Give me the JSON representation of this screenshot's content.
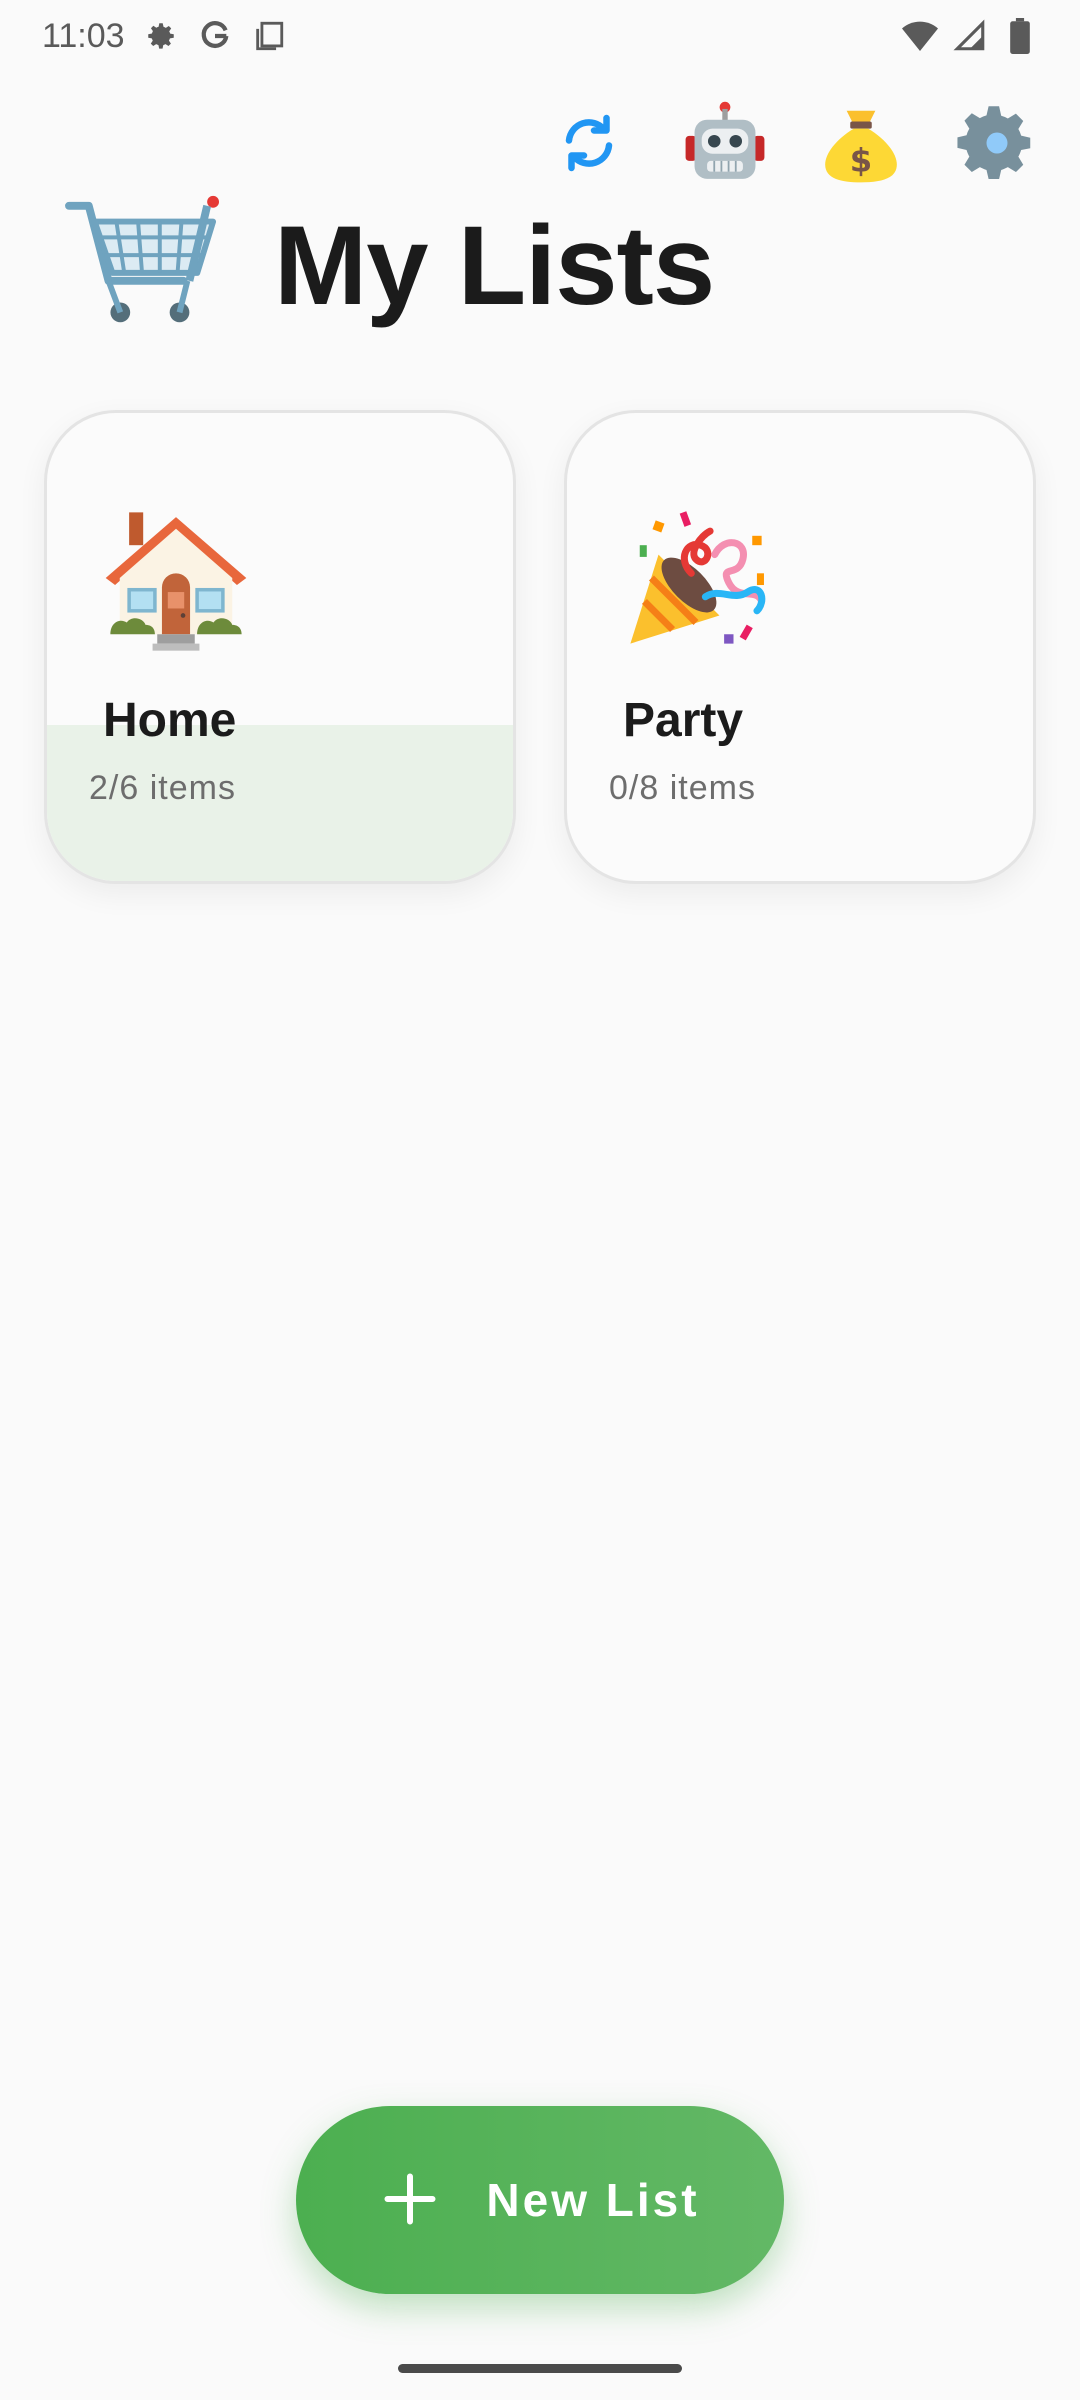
{
  "status_bar": {
    "time": "11:03",
    "icons": [
      "settings-icon",
      "google-icon",
      "clipboard-icon",
      "wifi-icon",
      "signal-icon",
      "battery-icon"
    ]
  },
  "actions": [
    {
      "name": "sync",
      "glyph": "🔄"
    },
    {
      "name": "assistant",
      "glyph": "🤖"
    },
    {
      "name": "budget",
      "glyph": "💰"
    },
    {
      "name": "settings",
      "glyph": "⚙️"
    }
  ],
  "header": {
    "title": "My Lists",
    "icon": "shopping-cart-icon"
  },
  "lists": [
    {
      "name": "Home",
      "count_label": "2/6 items",
      "done": 2,
      "total": 6,
      "emoji": "house-icon"
    },
    {
      "name": "Party",
      "count_label": "0/8 items",
      "done": 0,
      "total": 8,
      "emoji": "party-popper-icon"
    }
  ],
  "fab": {
    "label": "New List"
  },
  "colors": {
    "accent": "#4CAF50",
    "progress_fill": "#E9F2E8",
    "background": "#FAFAFA"
  }
}
